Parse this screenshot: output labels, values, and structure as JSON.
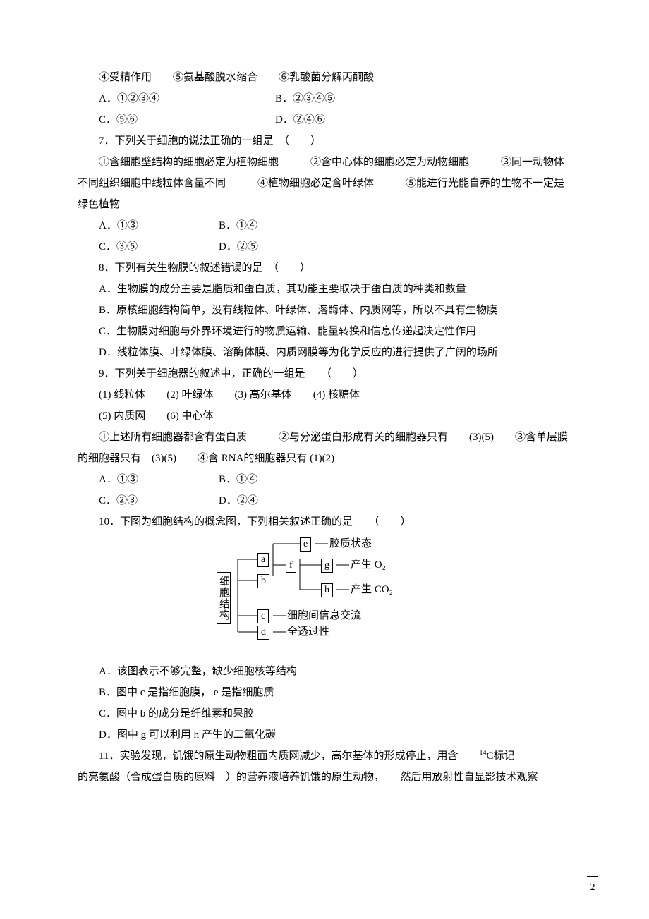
{
  "lines": {
    "l1": "④受精作用　　⑤氨基酸脱水缩合　　⑥乳酸菌分解丙酮酸",
    "l2a": "A．①②③④",
    "l2b": "B．②③④⑤",
    "l3a": "C．⑤⑥",
    "l3b": "D．②④⑥",
    "q7": "7．下列关于细胞的说法正确的一组是　（　　）",
    "q7_1": "①含细胞壁结构的细胞必定为植物细胞　　　②含中心体的细胞必定为动物细胞　　　③同一动物体不同组织细胞中线粒体含量不同　　　④植物细胞必定含叶绿体　　　⑤能进行光能自养的生物不一定是绿色植物",
    "q7Aa": "A．①③",
    "q7Ab": "B．①④",
    "q7Ba": "C．③⑤",
    "q7Bb": "D．②⑤",
    "q8": "8．下列有关生物膜的叙述错误的是　（　　）",
    "q8A": "A．生物膜的成分主要是脂质和蛋白质，其功能主要取决于蛋白质的种类和数量",
    "q8B": "B．原核细胞结构简单，没有线粒体、叶绿体、溶酶体、内质网等，所以不具有生物膜",
    "q8C": "C．生物膜对细胞与外界环境进行的物质运输、能量转换和信息传递起决定性作用",
    "q8D": "D．线粒体膜、叶绿体膜、溶酶体膜、内质网膜等为化学反应的进行提供了广阔的场所",
    "q9": "9．下列关于细胞器的叙述中，正确的一组是　　（　　）",
    "q9p1": "(1) 线粒体　　(2) 叶绿体　　(3) 高尔基体　　(4) 核糖体",
    "q9p2": "(5) 内质网　　(6) 中心体",
    "q9p3": "①上述所有细胞器都含有蛋白质　　　②与分泌蛋白形成有关的细胞器只有　　(3)(5)　　③含单层膜的细胞器只有　(3)(5)　　④含 RNA的细胞器只有 (1)(2)",
    "q9Aa": "A．①③",
    "q9Ab": "B．①④",
    "q9Ba": "C．②③",
    "q9Bb": "D．②④",
    "q10": "10．下图为细胞结构的概念图，下列相关叙述正确的是　　（　　）",
    "q10A": "A．该图表示不够完整，缺少细胞核等结构",
    "q10B": "B．图中 c 是指细胞膜， e 是指细胞质",
    "q10C": "C．图中 b 的成分是纤维素和果胶",
    "q10D": "D．图中 g 可以利用 h 产生的二氧化碳",
    "q11a": "11．实验发现，饥饿的原生动物粗面内质网减少，高尔基体的形成停止，用含　　",
    "q11sup": "14",
    "q11b": "C标记",
    "q11c": "的亮氨酸（合成蛋白质的原料　）的营养液培养饥饿的原生动物，　　然后用放射性自显影技术观察"
  },
  "diagram": {
    "root": "细胞结构",
    "a": "a",
    "b": "b",
    "c": "c",
    "d": "d",
    "e": "e",
    "f": "f",
    "g": "g",
    "h": "h",
    "e_lab": "胶质状态",
    "g_lab": "产生 O₂",
    "h_lab": "产生 CO₂",
    "c_lab": "细胞间信息交流",
    "d_lab": "全透过性"
  },
  "page_number": "2"
}
